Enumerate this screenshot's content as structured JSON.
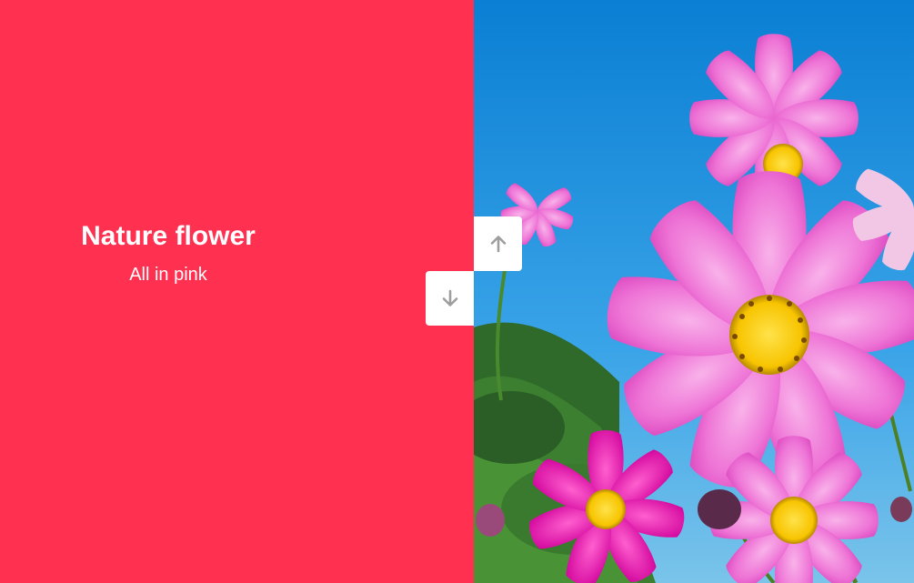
{
  "slide": {
    "title": "Nature flower",
    "subtitle": "All in pink",
    "background_color": "#ff3050",
    "image": "pink-cosmos-flowers-blue-sky"
  },
  "navigation": {
    "up_icon": "arrow-up-icon",
    "down_icon": "arrow-down-icon",
    "icon_color": "#9e9e9e"
  },
  "colors": {
    "sky": "#0a86d8",
    "petal": "#f27ed8",
    "petal_dark": "#e048c4",
    "center": "#ffd21e"
  }
}
